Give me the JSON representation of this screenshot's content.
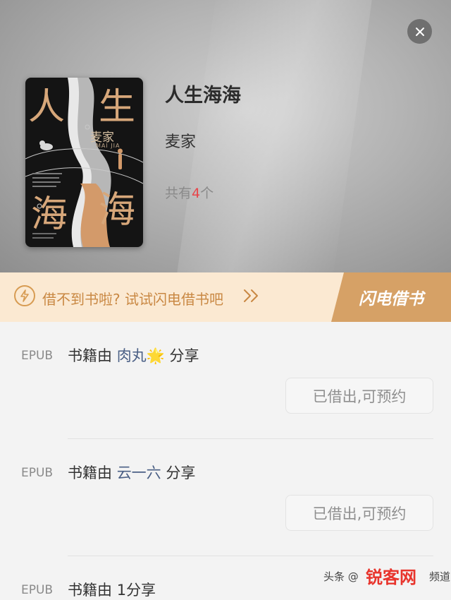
{
  "book": {
    "title": "人生海海",
    "author": "麦家",
    "count_prefix": "共有",
    "count_number": "4",
    "count_suffix": "个"
  },
  "cover": {
    "big_char_1": "人",
    "big_char_2": "生",
    "big_char_3": "海",
    "big_char_4": "海",
    "author": "麦家",
    "author_en": "MAI JIA"
  },
  "banner": {
    "text": "借不到书啦? 试试闪电借书吧",
    "button_label": "闪电借书"
  },
  "shares": [
    {
      "format": "EPUB",
      "prefix": "书籍由",
      "user": "肉丸",
      "emoji": "🌟",
      "suffix": "分享",
      "button": "已借出,可预约"
    },
    {
      "format": "EPUB",
      "prefix": "书籍由",
      "user": "云一六",
      "emoji": "",
      "suffix": "分享",
      "button": "已借出,可预约"
    },
    {
      "format": "EPUB",
      "prefix": "书籍由",
      "user": "1",
      "emoji": "",
      "suffix": "分享",
      "button": ""
    }
  ],
  "watermark": {
    "text": "头条 @",
    "logo": "锐客网",
    "tail": "频道"
  },
  "colors": {
    "accent_red": "#e8454a",
    "banner_bg": "#fbe9d2",
    "banner_btn": "#d6a166",
    "username_blue": "#4a5f85"
  }
}
